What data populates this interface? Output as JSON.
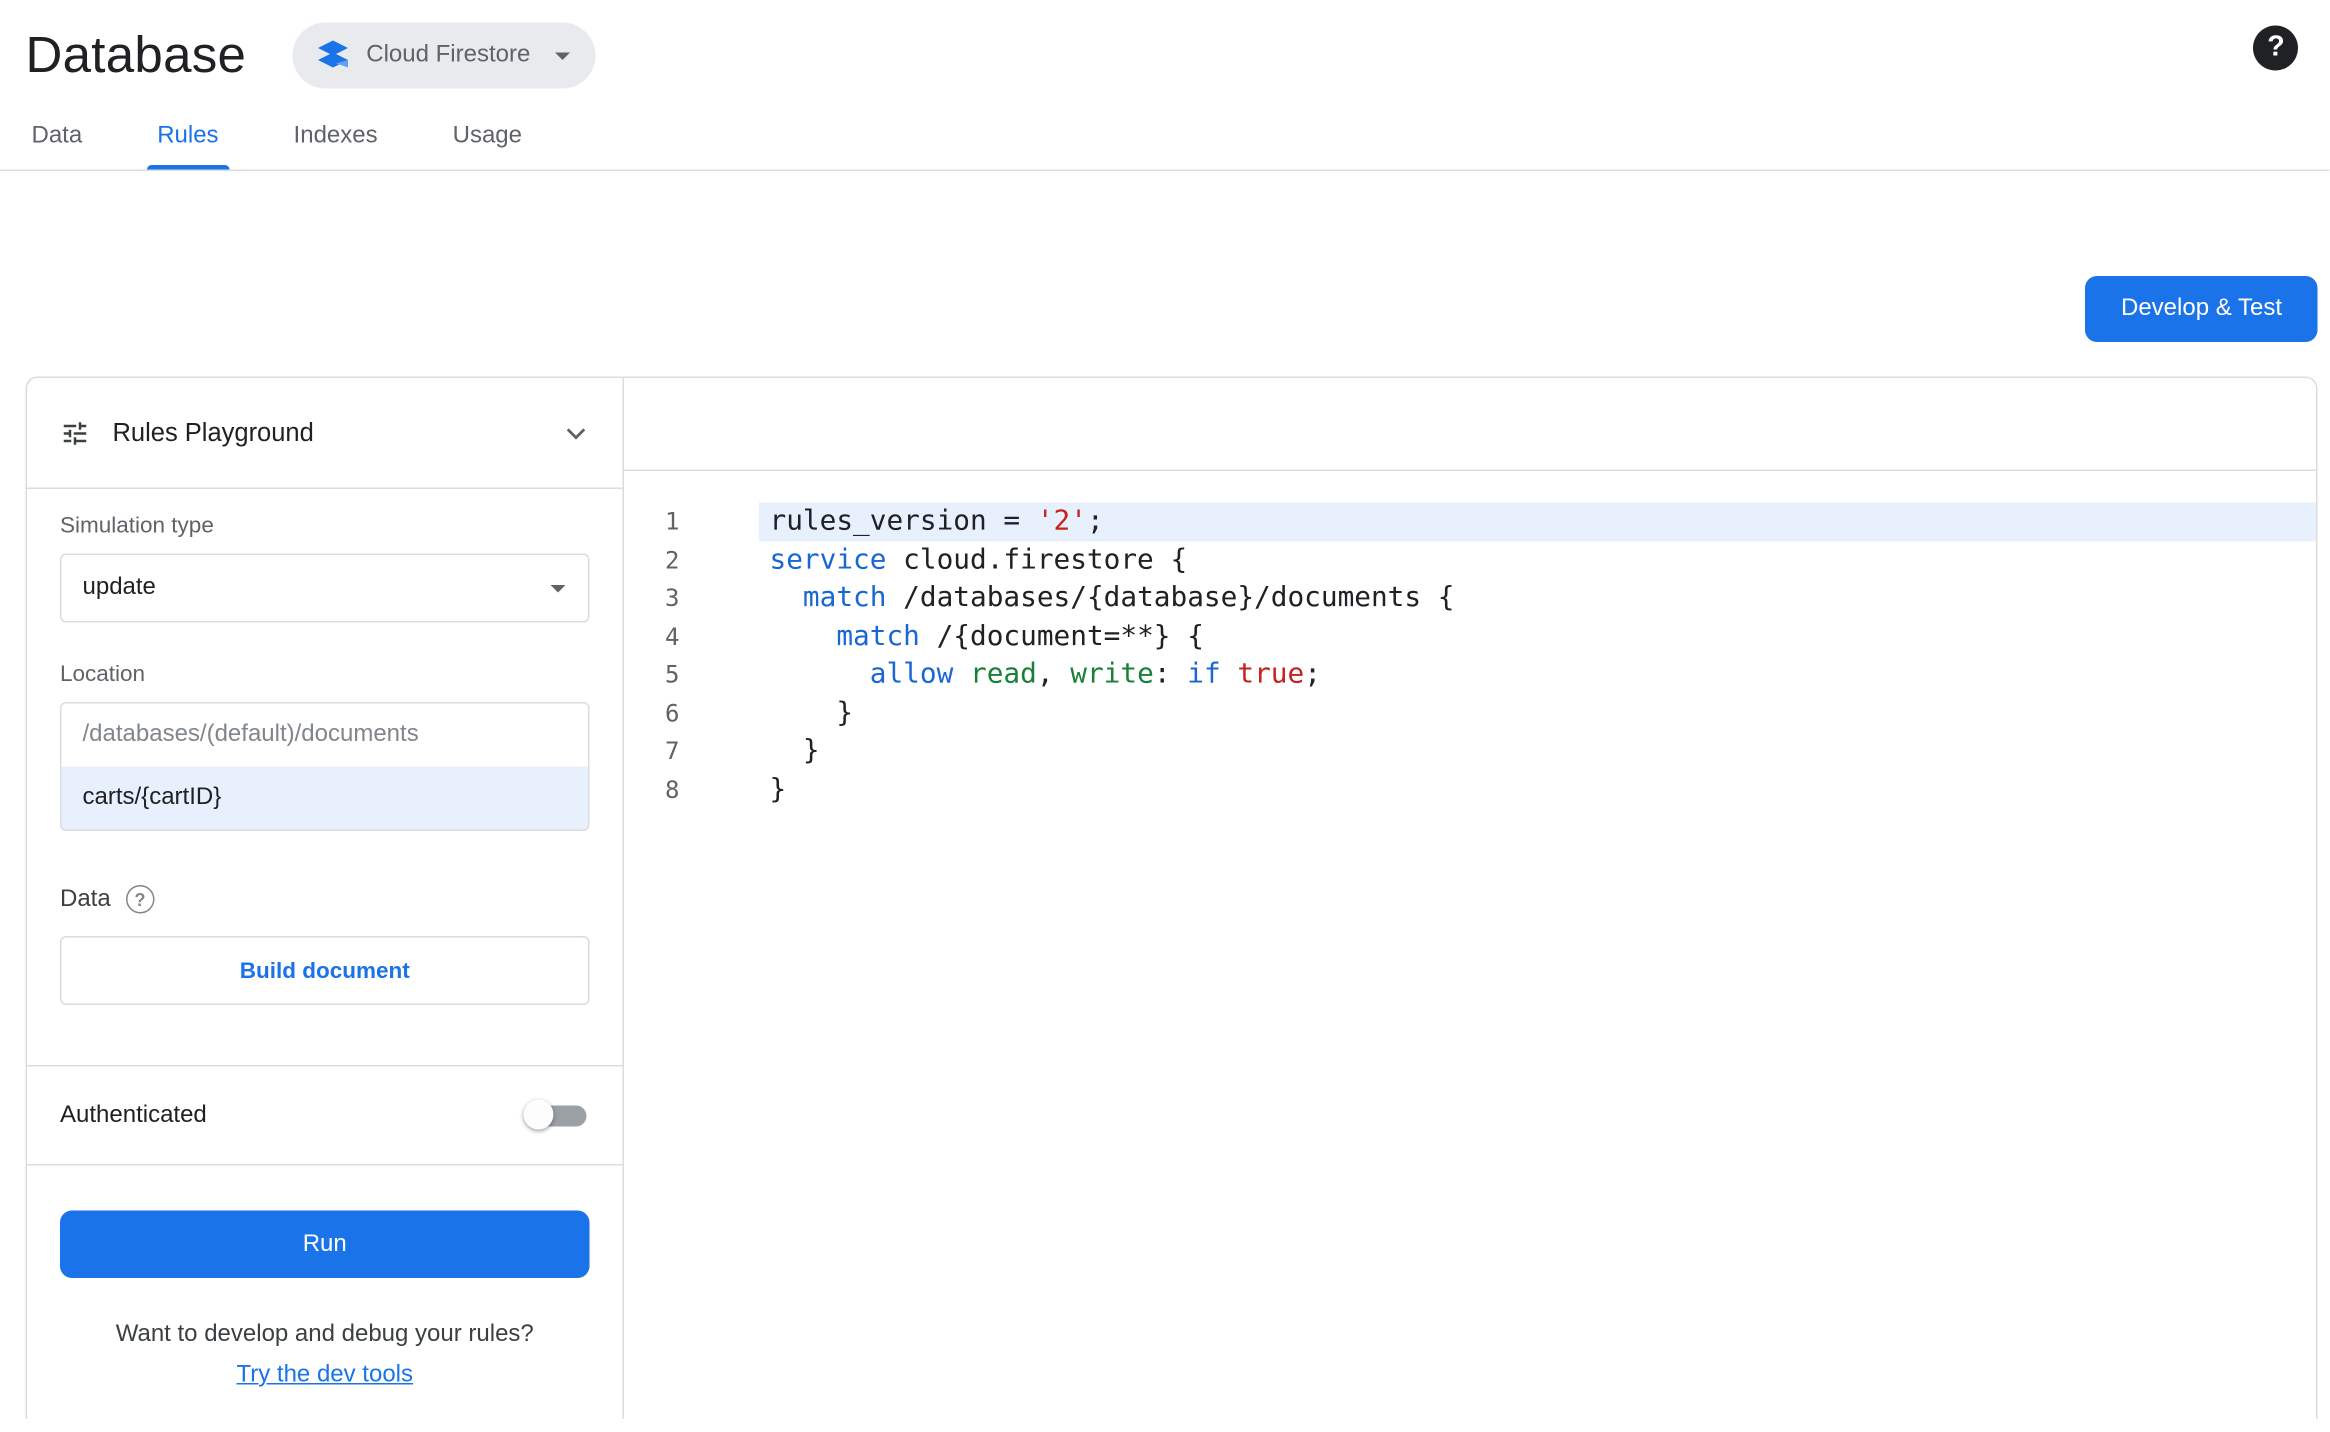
{
  "header": {
    "title": "Database",
    "product_chip": "Cloud Firestore"
  },
  "tabs": [
    {
      "label": "Data",
      "active": false
    },
    {
      "label": "Rules",
      "active": true
    },
    {
      "label": "Indexes",
      "active": false
    },
    {
      "label": "Usage",
      "active": false
    }
  ],
  "actions": {
    "develop_test": "Develop & Test"
  },
  "playground": {
    "title": "Rules Playground",
    "simulation_type_label": "Simulation type",
    "simulation_type_value": "update",
    "location_label": "Location",
    "location_prefix": "/databases/(default)/documents",
    "location_value": "carts/{cartID}",
    "data_label": "Data",
    "data_help": "?",
    "build_document_label": "Build document",
    "authenticated_label": "Authenticated",
    "authenticated_on": false,
    "run_label": "Run",
    "footer_question": "Want to develop and debug your rules?",
    "footer_link": "Try the dev tools"
  },
  "help_glyph": "?",
  "icons": {
    "product": "firestore-layers",
    "chip_caret": "caret-down",
    "header_help": "help-filled-circle",
    "playground": "tune-sliders",
    "collapse": "chevron-down",
    "select_caret": "caret-down",
    "data_help": "question-circle-outline"
  },
  "colors": {
    "accent": "#1a73e8",
    "keyword": "#1967d2",
    "string": "#c5221f",
    "rule_verb": "#188038",
    "border": "#dadce0",
    "active_line_bg": "#e8f0fe",
    "chip_bg": "#e8eaed"
  },
  "editor": {
    "active_line": 0,
    "lines": [
      [
        {
          "t": "rules_version = ",
          "c": "p"
        },
        {
          "t": "'2'",
          "c": "s"
        },
        {
          "t": ";",
          "c": "p"
        }
      ],
      [
        {
          "t": "service",
          "c": "k"
        },
        {
          "t": " cloud.firestore {",
          "c": "p"
        }
      ],
      [
        {
          "t": "  ",
          "c": "p"
        },
        {
          "t": "match",
          "c": "k"
        },
        {
          "t": " /databases/{database}/documents {",
          "c": "p"
        }
      ],
      [
        {
          "t": "    ",
          "c": "p"
        },
        {
          "t": "match",
          "c": "k"
        },
        {
          "t": " /{document=**} {",
          "c": "p"
        }
      ],
      [
        {
          "t": "      ",
          "c": "p"
        },
        {
          "t": "allow",
          "c": "k"
        },
        {
          "t": " ",
          "c": "p"
        },
        {
          "t": "read",
          "c": "g"
        },
        {
          "t": ", ",
          "c": "p"
        },
        {
          "t": "write",
          "c": "g"
        },
        {
          "t": ": ",
          "c": "p"
        },
        {
          "t": "if",
          "c": "k"
        },
        {
          "t": " ",
          "c": "p"
        },
        {
          "t": "true",
          "c": "s"
        },
        {
          "t": ";",
          "c": "p"
        }
      ],
      [
        {
          "t": "    }",
          "c": "p"
        }
      ],
      [
        {
          "t": "  }",
          "c": "p"
        }
      ],
      [
        {
          "t": "}",
          "c": "p"
        }
      ]
    ]
  }
}
